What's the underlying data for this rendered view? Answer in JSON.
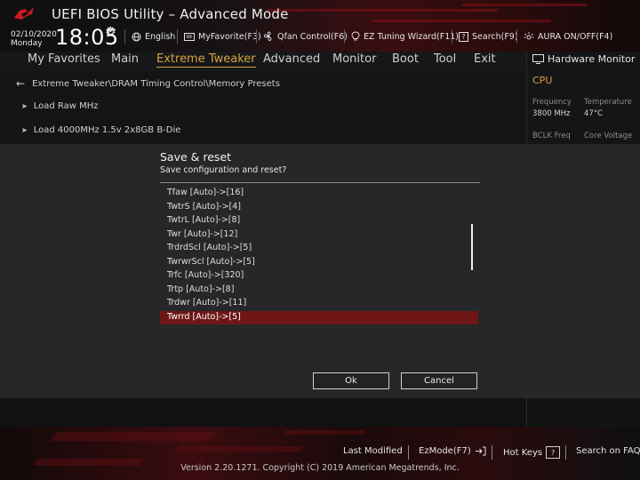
{
  "app": {
    "title": "UEFI BIOS Utility – Advanced Mode",
    "date": "02/10/2020",
    "day": "Monday",
    "time": "18:05"
  },
  "toolbar": {
    "language": "English",
    "my_favorite": "MyFavorite(F3)",
    "qfan": "Qfan Control(F6)",
    "ez_tuning": "EZ Tuning Wizard(F11)",
    "search": "Search(F9)",
    "aura": "AURA ON/OFF(F4)"
  },
  "menu": {
    "items": [
      "My Favorites",
      "Main",
      "Extreme Tweaker",
      "Advanced",
      "Monitor",
      "Boot",
      "Tool",
      "Exit"
    ],
    "active_index": 2
  },
  "content": {
    "breadcrumb": "Extreme Tweaker\\DRAM Timing Control\\Memory Presets",
    "rows": [
      "Load Raw MHz",
      "Load 4000MHz 1.5v 2x8GB B-Die"
    ]
  },
  "hardware_monitor": {
    "title": "Hardware Monitor",
    "section": "CPU",
    "frequency_label": "Frequency",
    "frequency_value": "3800 MHz",
    "temperature_label": "Temperature",
    "temperature_value": "47°C",
    "bclk_label": "BCLK Freq",
    "core_voltage_label": "Core Voltage"
  },
  "dialog": {
    "title": "Save & reset",
    "subtitle": "Save configuration and reset?",
    "items": [
      "Tfaw [Auto]->[16]",
      "TwtrS [Auto]->[4]",
      "TwtrL [Auto]->[8]",
      "Twr [Auto]->[12]",
      "TrdrdScl [Auto]->[5]",
      "TwrwrScl [Auto]->[5]",
      "Trfc [Auto]->[320]",
      "Trtp [Auto]->[8]",
      "Trdwr [Auto]->[11]",
      "Twrrd [Auto]->[5]"
    ],
    "selected_index": 9,
    "ok_label": "Ok",
    "cancel_label": "Cancel"
  },
  "footer": {
    "last_modified": "Last Modified",
    "ez_mode": "EzMode(F7)",
    "hot_keys": "Hot Keys",
    "hot_keys_key": "?",
    "search_faq": "Search on FAQ",
    "copyright": "Version 2.20.1271. Copyright (C) 2019 American Megatrends, Inc."
  },
  "colors": {
    "accent": "#d7a23b",
    "selection": "#6f1717",
    "brand_red": "#7b1015"
  }
}
